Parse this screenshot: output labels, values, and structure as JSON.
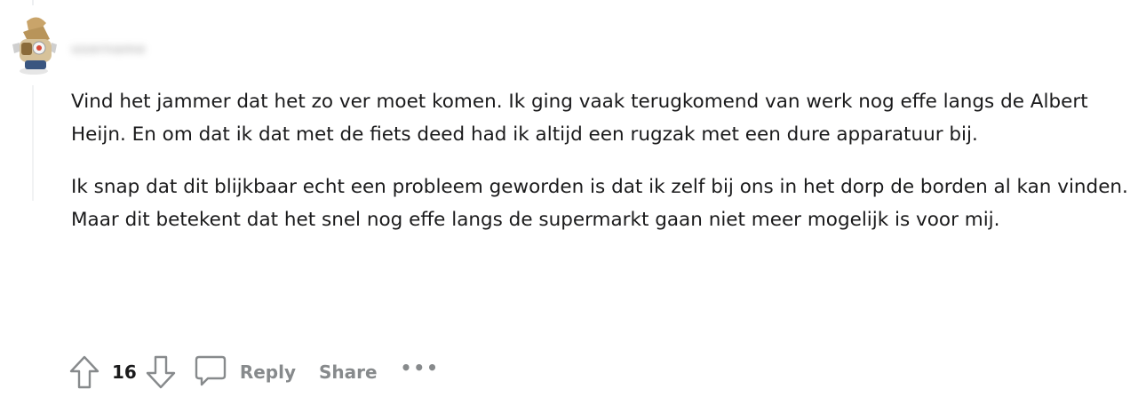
{
  "comment": {
    "username": "username",
    "paragraphs": [
      "Vind het jammer dat het zo ver moet komen. Ik ging vaak terugkomend van werk nog effe langs de Albert Heijn. En om dat ik dat met de fiets deed had ik altijd een rugzak met een dure apparatuur bij.",
      "Ik snap dat dit blijkbaar echt een probleem geworden is dat ik zelf bij ons in het dorp de borden al kan vinden. Maar dit betekent dat het snel nog effe langs de supermarkt gaan niet meer mogelijk is voor mij."
    ]
  },
  "actions": {
    "upvote_icon": "upvote-arrow-icon",
    "score": "16",
    "downvote_icon": "downvote-arrow-icon",
    "reply_icon": "speech-bubble-icon",
    "reply_label": "Reply",
    "share_label": "Share",
    "more_label": "•••"
  },
  "colors": {
    "text": "#1a1a1b",
    "muted": "#878a8c",
    "thread_line": "#edeff1"
  }
}
